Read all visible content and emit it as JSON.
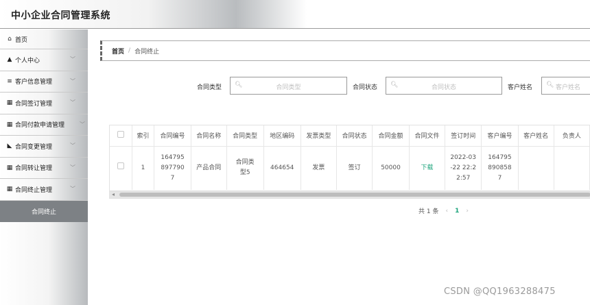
{
  "app": {
    "title": "中小企业合同管理系统"
  },
  "sidebar": {
    "items": [
      {
        "icon": "home-icon",
        "glyph": "⌂",
        "label": "首页"
      },
      {
        "icon": "user-icon",
        "glyph": "▲",
        "label": "个人中心"
      },
      {
        "icon": "list-icon",
        "glyph": "≡",
        "label": "客户信息管理"
      },
      {
        "icon": "grid-icon",
        "glyph": "▦",
        "label": "合同签订管理"
      },
      {
        "icon": "grid-icon",
        "glyph": "▦",
        "label": "合同付款申请管理"
      },
      {
        "icon": "tag-icon",
        "glyph": "◣",
        "label": "合同变更管理"
      },
      {
        "icon": "grid-icon",
        "glyph": "▦",
        "label": "合同转让管理"
      },
      {
        "icon": "table-icon",
        "glyph": "▦",
        "label": "合同终止管理"
      }
    ],
    "active_label": "合同终止"
  },
  "breadcrumb": {
    "home": "首页",
    "separator": "/",
    "current": "合同终止"
  },
  "filters": [
    {
      "label": "合同类型",
      "placeholder": "合同类型"
    },
    {
      "label": "合同状态",
      "placeholder": "合同状态"
    },
    {
      "label": "客户姓名",
      "placeholder": "客户姓名"
    }
  ],
  "table": {
    "headers": [
      "",
      "索引",
      "合同编号",
      "合同名称",
      "合同类型",
      "地区编码",
      "发票类型",
      "合同状态",
      "合同金额",
      "合同文件",
      "签订时间",
      "客户编号",
      "客户姓名",
      "负责人"
    ],
    "rows": [
      {
        "index": "1",
        "contract_no": "1647958977907",
        "contract_name": "产品合同",
        "contract_type": "合同类型5",
        "region_code": "464654",
        "invoice_type": "发票",
        "status": "签订",
        "amount": "50000",
        "file": "下载",
        "sign_time": "2022-03-22 22:22:57",
        "customer_no": "1647958908587",
        "customer_name": "",
        "owner": ""
      }
    ]
  },
  "pagination": {
    "total": "共 1 条",
    "prev": "‹",
    "current": "1",
    "next": "›"
  },
  "watermark": "CSDN @QQ1963288475",
  "colors": {
    "accent": "#1aa37a",
    "sidebar_active": "#7d8185"
  }
}
